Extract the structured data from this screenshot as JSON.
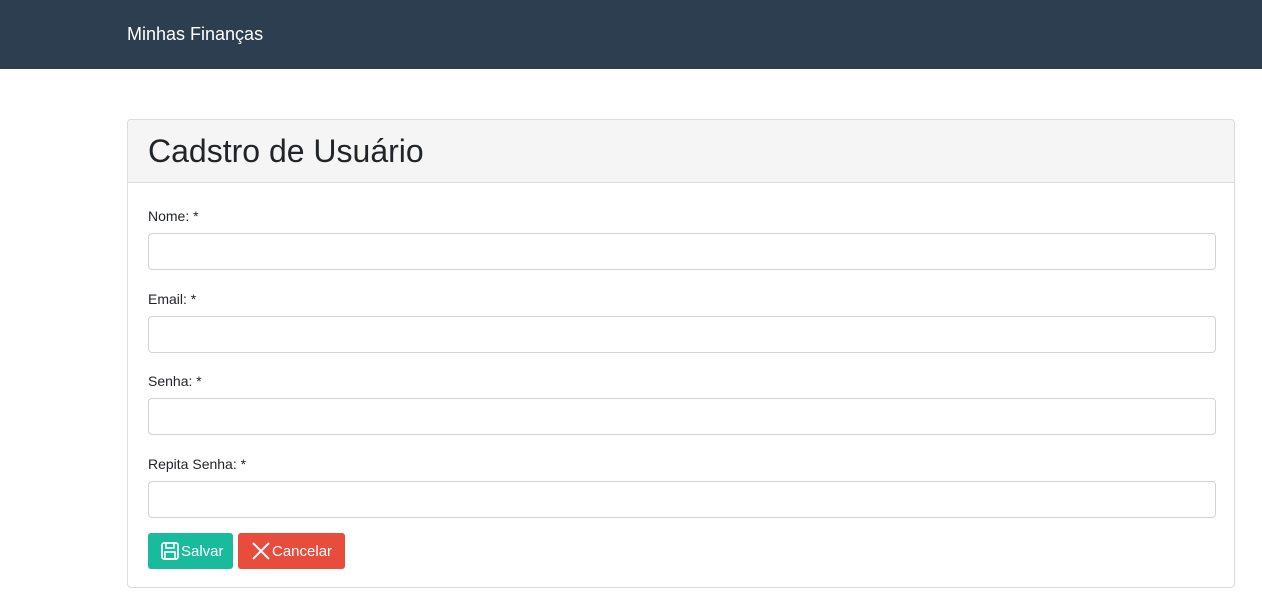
{
  "navbar": {
    "brand": "Minhas Finanças"
  },
  "card": {
    "title": "Cadstro de Usuário"
  },
  "form": {
    "fields": [
      {
        "label": "Nome: *",
        "value": "",
        "placeholder": ""
      },
      {
        "label": "Email: *",
        "value": "",
        "placeholder": ""
      },
      {
        "label": "Senha: *",
        "value": "",
        "placeholder": ""
      },
      {
        "label": "Repita Senha: *",
        "value": "",
        "placeholder": ""
      }
    ]
  },
  "buttons": {
    "save": {
      "label": "Salvar",
      "icon": "save-icon",
      "color": "#18bc9c"
    },
    "cancel": {
      "label": "Cancelar",
      "icon": "close-icon",
      "color": "#e74c3c"
    }
  },
  "colors": {
    "navbar": "#2c3e50",
    "card_header": "#f5f5f5"
  }
}
